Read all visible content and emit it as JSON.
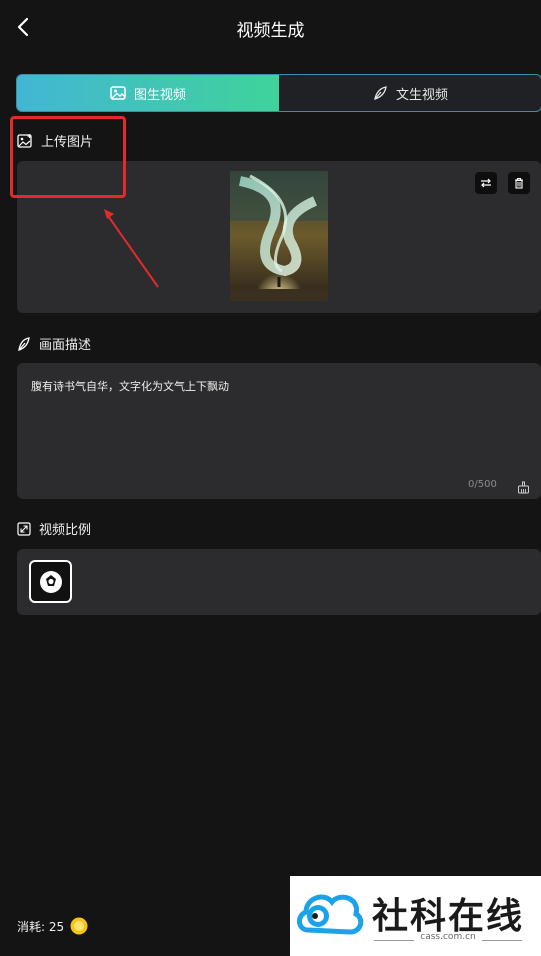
{
  "header": {
    "title": "视频生成"
  },
  "tabs": [
    {
      "label": "图生视频",
      "active": true
    },
    {
      "label": "文生视频",
      "active": false
    }
  ],
  "upload": {
    "label": "上传图片"
  },
  "description": {
    "label": "画面描述",
    "value": "腹有诗书气自华，文字化为文气上下飘动",
    "counter": "0/500"
  },
  "ratio": {
    "label": "视频比例"
  },
  "footer": {
    "cost_label": "消耗: 25"
  },
  "watermark": {
    "brand": "社科在线",
    "url": "cass.com.cn"
  },
  "colors": {
    "accent_start": "#43b6d4",
    "accent_end": "#3fd39a",
    "highlight": "#e22b2b",
    "panel": "#2c2c2e",
    "background": "#141414",
    "coin": "#f5c518"
  },
  "icons": {
    "back": "chevron-left-icon",
    "image_tab": "image-icon",
    "text_tab": "feather-icon",
    "upload": "image-upload-icon",
    "swap": "swap-icon",
    "delete": "trash-icon",
    "description": "feather-icon",
    "clear": "broom-icon",
    "ratio": "expand-icon",
    "ratio_option": "aperture-icon",
    "coin": "coin-icon"
  }
}
